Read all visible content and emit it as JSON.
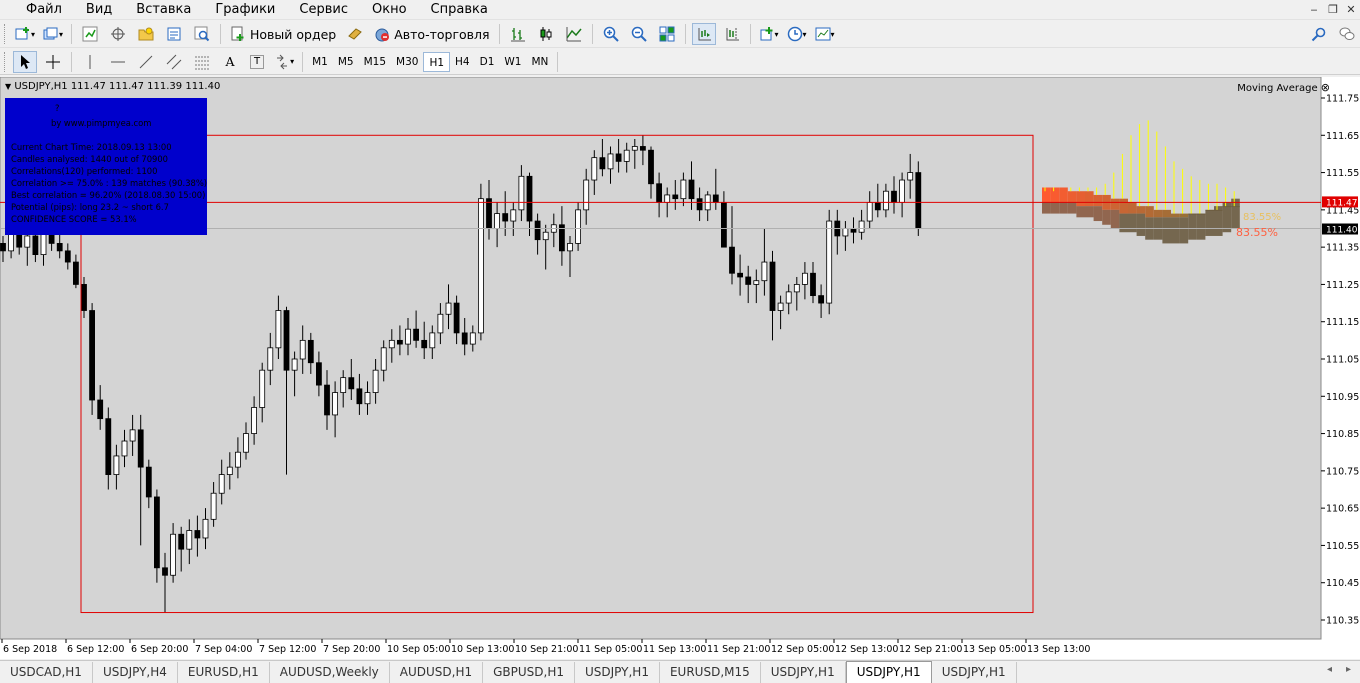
{
  "menu": [
    "Файл",
    "Вид",
    "Вставка",
    "Графики",
    "Сервис",
    "Окно",
    "Справка"
  ],
  "toolbar": {
    "new_order": "Новый ордер",
    "auto_trading": "Авто-торговля",
    "timeframes": [
      "M1",
      "M5",
      "M15",
      "M30",
      "H1",
      "H4",
      "D1",
      "W1",
      "MN"
    ],
    "active_timeframe": "H1",
    "line_tools": [
      "A",
      "T"
    ]
  },
  "chart": {
    "header": "USDJPY,H1  111.47 111.47 111.39 111.40",
    "indicator": "Moving Average",
    "price_axis": [
      "111.75",
      "111.65",
      "111.55",
      "111.45",
      "111.35",
      "111.25",
      "111.15",
      "111.05",
      "110.95",
      "110.85",
      "110.75",
      "110.65",
      "110.55",
      "110.45",
      "110.35"
    ],
    "time_axis": [
      "6 Sep 2018",
      "6 Sep 12:00",
      "6 Sep 20:00",
      "7 Sep 04:00",
      "7 Sep 12:00",
      "7 Sep 20:00",
      "10 Sep 05:00",
      "10 Sep 13:00",
      "10 Sep 21:00",
      "11 Sep 05:00",
      "11 Sep 13:00",
      "11 Sep 21:00",
      "12 Sep 05:00",
      "12 Sep 13:00",
      "12 Sep 21:00",
      "13 Sep 05:00",
      "13 Sep 13:00"
    ],
    "price_tags": {
      "ask": "111.47",
      "bid": "111.40"
    },
    "projection_label_1": "83.55%",
    "projection_label_2": "83.55%",
    "colors": {
      "background": "#d4d4d4",
      "box": "#e00000",
      "info_panel": "#0000cc",
      "projection_orange": "#ff5a30",
      "projection_dark": "#6a5b40",
      "yellow_lines": "#ffff00"
    }
  },
  "info_panel": {
    "line1": "?",
    "line2": "by www.pimpmyea.com",
    "line3": "Current Chart Time: 2018.09.13 13:00",
    "line4": "Candles analysed: 1440 out of 70900",
    "line5": "Correlations(120) performed: 1100",
    "line6": "Correlation >= 75.0% : 139 matches (90.38%)",
    "line7": "Best correlation = 96.20% (2018.08.30 15:00)",
    "line8": "Potential (pips): long 23.2 ~ short 6.7",
    "line9": "CONFIDENCE SCORE = 53.1%"
  },
  "tabs": [
    "USDCAD,H1",
    "USDJPY,H4",
    "EURUSD,H1",
    "AUDUSD,Weekly",
    "AUDUSD,H1",
    "GBPUSD,H1",
    "USDJPY,H1",
    "EURUSD,M15",
    "USDJPY,H1",
    "USDJPY,H1",
    "USDJPY,H1"
  ],
  "active_tab_index": 9,
  "candles_ohlc": [
    [
      111.36,
      111.38,
      111.31,
      111.34
    ],
    [
      111.34,
      111.42,
      111.32,
      111.4
    ],
    [
      111.4,
      111.43,
      111.33,
      111.35
    ],
    [
      111.35,
      111.41,
      111.3,
      111.38
    ],
    [
      111.38,
      111.4,
      111.31,
      111.33
    ],
    [
      111.33,
      111.42,
      111.3,
      111.39
    ],
    [
      111.39,
      111.41,
      111.34,
      111.36
    ],
    [
      111.36,
      111.39,
      111.32,
      111.34
    ],
    [
      111.34,
      111.36,
      111.29,
      111.31
    ],
    [
      111.31,
      111.33,
      111.24,
      111.25
    ],
    [
      111.25,
      111.27,
      111.16,
      111.18
    ],
    [
      111.18,
      111.2,
      110.9,
      110.94
    ],
    [
      110.94,
      110.98,
      110.86,
      110.89
    ],
    [
      110.89,
      110.92,
      110.7,
      110.74
    ],
    [
      110.74,
      110.82,
      110.7,
      110.79
    ],
    [
      110.79,
      110.86,
      110.76,
      110.83
    ],
    [
      110.83,
      110.9,
      110.79,
      110.86
    ],
    [
      110.86,
      110.9,
      110.55,
      110.76
    ],
    [
      110.76,
      110.78,
      110.65,
      110.68
    ],
    [
      110.68,
      110.7,
      110.45,
      110.49
    ],
    [
      110.49,
      110.53,
      110.37,
      110.47
    ],
    [
      110.47,
      110.61,
      110.45,
      110.58
    ],
    [
      110.58,
      110.6,
      110.48,
      110.54
    ],
    [
      110.54,
      110.62,
      110.5,
      110.59
    ],
    [
      110.59,
      110.63,
      110.52,
      110.57
    ],
    [
      110.57,
      110.65,
      110.54,
      110.62
    ],
    [
      110.62,
      110.72,
      110.6,
      110.69
    ],
    [
      110.69,
      110.78,
      110.66,
      110.74
    ],
    [
      110.74,
      110.8,
      110.7,
      110.76
    ],
    [
      110.76,
      110.84,
      110.73,
      110.8
    ],
    [
      110.8,
      110.88,
      110.78,
      110.85
    ],
    [
      110.85,
      110.95,
      110.82,
      110.92
    ],
    [
      110.92,
      111.04,
      110.88,
      111.02
    ],
    [
      111.02,
      111.12,
      110.98,
      111.08
    ],
    [
      111.08,
      111.22,
      111.05,
      111.18
    ],
    [
      111.18,
      111.19,
      110.74,
      111.02
    ],
    [
      111.02,
      111.07,
      110.95,
      111.05
    ],
    [
      111.05,
      111.14,
      111.01,
      111.1
    ],
    [
      111.1,
      111.12,
      111.01,
      111.04
    ],
    [
      111.04,
      111.07,
      110.95,
      110.98
    ],
    [
      110.98,
      111.02,
      110.86,
      110.9
    ],
    [
      110.9,
      110.99,
      110.84,
      110.96
    ],
    [
      110.96,
      111.02,
      110.92,
      111.0
    ],
    [
      111.0,
      111.05,
      110.94,
      110.97
    ],
    [
      110.97,
      111.01,
      110.9,
      110.93
    ],
    [
      110.93,
      110.99,
      110.9,
      110.96
    ],
    [
      110.96,
      111.05,
      110.93,
      111.02
    ],
    [
      111.02,
      111.1,
      110.99,
      111.08
    ],
    [
      111.08,
      111.13,
      111.04,
      111.1
    ],
    [
      111.1,
      111.14,
      111.06,
      111.09
    ],
    [
      111.09,
      111.16,
      111.06,
      111.13
    ],
    [
      111.13,
      111.18,
      111.08,
      111.1
    ],
    [
      111.1,
      111.15,
      111.05,
      111.08
    ],
    [
      111.08,
      111.14,
      111.05,
      111.12
    ],
    [
      111.12,
      111.2,
      111.09,
      111.17
    ],
    [
      111.17,
      111.25,
      111.13,
      111.2
    ],
    [
      111.2,
      111.22,
      111.09,
      111.12
    ],
    [
      111.12,
      111.16,
      111.06,
      111.09
    ],
    [
      111.09,
      111.14,
      111.07,
      111.12
    ],
    [
      111.12,
      111.52,
      111.1,
      111.48
    ],
    [
      111.48,
      111.53,
      111.37,
      111.4
    ],
    [
      111.4,
      111.47,
      111.35,
      111.44
    ],
    [
      111.44,
      111.5,
      111.38,
      111.42
    ],
    [
      111.42,
      111.47,
      111.38,
      111.45
    ],
    [
      111.45,
      111.57,
      111.42,
      111.54
    ],
    [
      111.54,
      111.55,
      111.38,
      111.42
    ],
    [
      111.42,
      111.44,
      111.33,
      111.37
    ],
    [
      111.37,
      111.41,
      111.29,
      111.39
    ],
    [
      111.39,
      111.44,
      111.35,
      111.41
    ],
    [
      111.41,
      111.46,
      111.3,
      111.34
    ],
    [
      111.34,
      111.38,
      111.27,
      111.36
    ],
    [
      111.36,
      111.47,
      111.34,
      111.45
    ],
    [
      111.45,
      111.56,
      111.41,
      111.53
    ],
    [
      111.53,
      111.61,
      111.49,
      111.59
    ],
    [
      111.59,
      111.64,
      111.54,
      111.56
    ],
    [
      111.56,
      111.62,
      111.52,
      111.6
    ],
    [
      111.6,
      111.64,
      111.55,
      111.58
    ],
    [
      111.58,
      111.63,
      111.55,
      111.61
    ],
    [
      111.61,
      111.64,
      111.56,
      111.62
    ],
    [
      111.62,
      111.65,
      111.57,
      111.61
    ],
    [
      111.61,
      111.62,
      111.48,
      111.52
    ],
    [
      111.52,
      111.55,
      111.43,
      111.47
    ],
    [
      111.47,
      111.51,
      111.43,
      111.49
    ],
    [
      111.49,
      111.53,
      111.45,
      111.48
    ],
    [
      111.48,
      111.55,
      111.46,
      111.53
    ],
    [
      111.53,
      111.58,
      111.45,
      111.48
    ],
    [
      111.48,
      111.51,
      111.42,
      111.45
    ],
    [
      111.45,
      111.5,
      111.42,
      111.49
    ],
    [
      111.49,
      111.56,
      111.45,
      111.47
    ],
    [
      111.47,
      111.5,
      111.4,
      111.35
    ],
    [
      111.35,
      111.46,
      111.25,
      111.28
    ],
    [
      111.28,
      111.33,
      111.22,
      111.27
    ],
    [
      111.27,
      111.3,
      111.2,
      111.25
    ],
    [
      111.25,
      111.29,
      111.2,
      111.26
    ],
    [
      111.26,
      111.4,
      111.22,
      111.31
    ],
    [
      111.31,
      111.34,
      111.1,
      111.18
    ],
    [
      111.18,
      111.22,
      111.13,
      111.2
    ],
    [
      111.2,
      111.25,
      111.17,
      111.23
    ],
    [
      111.23,
      111.27,
      111.18,
      111.25
    ],
    [
      111.25,
      111.31,
      111.21,
      111.28
    ],
    [
      111.28,
      111.31,
      111.2,
      111.22
    ],
    [
      111.22,
      111.25,
      111.16,
      111.2
    ],
    [
      111.2,
      111.45,
      111.17,
      111.42
    ],
    [
      111.42,
      111.45,
      111.33,
      111.38
    ],
    [
      111.38,
      111.42,
      111.34,
      111.4
    ],
    [
      111.4,
      111.43,
      111.36,
      111.39
    ],
    [
      111.39,
      111.45,
      111.37,
      111.42
    ],
    [
      111.42,
      111.5,
      111.4,
      111.47
    ],
    [
      111.47,
      111.52,
      111.43,
      111.45
    ],
    [
      111.45,
      111.52,
      111.43,
      111.5
    ],
    [
      111.5,
      111.54,
      111.44,
      111.47
    ],
    [
      111.47,
      111.55,
      111.43,
      111.53
    ],
    [
      111.53,
      111.6,
      111.48,
      111.55
    ],
    [
      111.55,
      111.58,
      111.38,
      111.4
    ]
  ],
  "projection": {
    "orange_upper": [
      111.51,
      111.51,
      111.51,
      111.5,
      111.5,
      111.5,
      111.49,
      111.49,
      111.48,
      111.48,
      111.47,
      111.46,
      111.46,
      111.45,
      111.45,
      111.44,
      111.44,
      111.44,
      111.44,
      111.45,
      111.45,
      111.46,
      111.46
    ],
    "dark_lower": [
      111.44,
      111.44,
      111.44,
      111.44,
      111.43,
      111.43,
      111.42,
      111.41,
      111.4,
      111.39,
      111.39,
      111.38,
      111.37,
      111.37,
      111.36,
      111.36,
      111.36,
      111.37,
      111.37,
      111.38,
      111.38,
      111.39,
      111.4
    ],
    "dark_upper": [
      111.47,
      111.47,
      111.47,
      111.47,
      111.46,
      111.46,
      111.46,
      111.45,
      111.45,
      111.44,
      111.44,
      111.44,
      111.43,
      111.43,
      111.43,
      111.43,
      111.43,
      111.44,
      111.44,
      111.45,
      111.46,
      111.47,
      111.48
    ],
    "yellow_high": [
      111.5,
      111.5,
      111.51,
      111.51,
      111.51,
      111.51,
      111.51,
      111.52,
      111.55,
      111.6,
      111.65,
      111.68,
      111.69,
      111.66,
      111.62,
      111.58,
      111.56,
      111.54,
      111.53,
      111.52,
      111.52,
      111.51,
      111.5
    ]
  }
}
